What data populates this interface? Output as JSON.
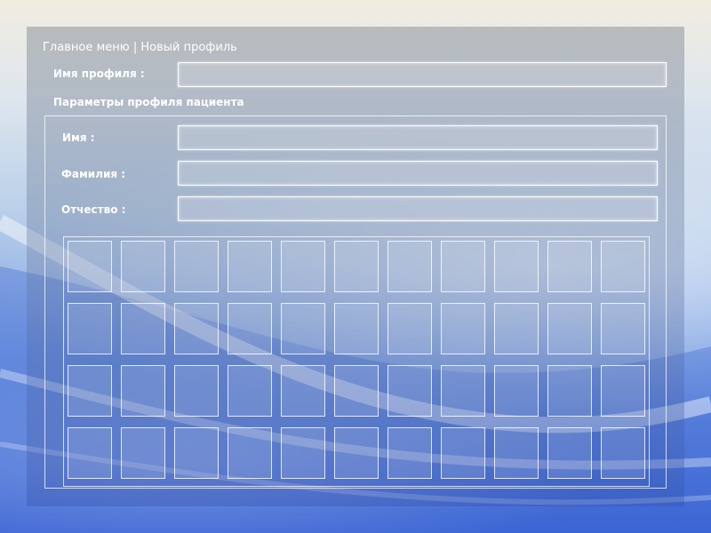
{
  "breadcrumb": {
    "text": "Главное меню | Новый профиль"
  },
  "profile": {
    "name_label": "Имя профиля :",
    "name_value": ""
  },
  "patient_params": {
    "title": "Параметры профиля пациента",
    "first_name_label": "Имя :",
    "first_name_value": "",
    "last_name_label": "Фамилия :",
    "last_name_value": "",
    "patronymic_label": "Отчество :",
    "patronymic_value": ""
  },
  "grid": {
    "rows": 4,
    "columns": 11
  },
  "colors": {
    "text": "#ffffff",
    "border": "#ffffff",
    "background_top": "#f1ece0",
    "background_bottom": "#3c66d6"
  }
}
